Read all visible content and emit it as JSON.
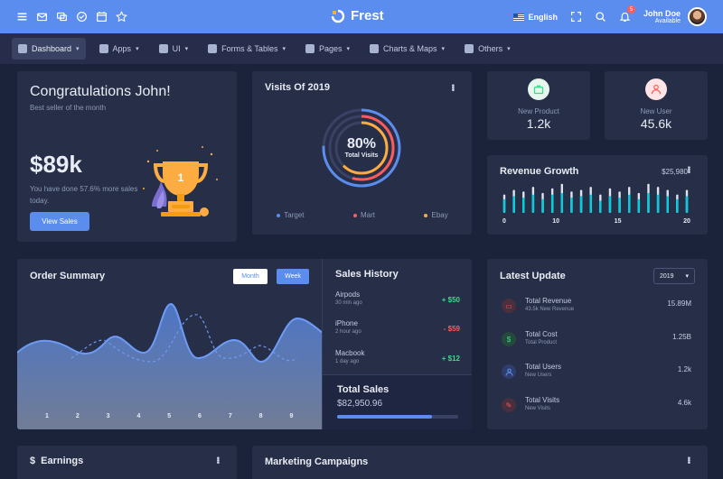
{
  "brand": {
    "name": "Frest"
  },
  "topbar": {
    "icons": [
      "menu-icon",
      "mail-icon",
      "chat-icon",
      "check-circle-icon",
      "calendar-icon",
      "star-icon"
    ],
    "language": "English",
    "notification_count": "5",
    "user": {
      "name": "John Doe",
      "status": "Available"
    }
  },
  "menu": [
    {
      "label": "Dashboard",
      "icon": "monitor-icon"
    },
    {
      "label": "Apps",
      "icon": "chat-icon"
    },
    {
      "label": "UI",
      "icon": "window-icon"
    },
    {
      "label": "Forms & Tables",
      "icon": "grid-icon"
    },
    {
      "label": "Pages",
      "icon": "page-icon"
    },
    {
      "label": "Charts & Maps",
      "icon": "pie-icon"
    },
    {
      "label": "Others",
      "icon": "folder-icon"
    }
  ],
  "congrats": {
    "title": "Congratulations John!",
    "subtitle": "Best seller of the month",
    "amount": "$89k",
    "description": "You have done 57.6% more sales today.",
    "button": "View Sales",
    "trophy_rank": "1"
  },
  "visits": {
    "title": "Visits Of 2019",
    "percent": "80%",
    "percent_value": 0.8,
    "label": "Total Visits",
    "legend": [
      {
        "name": "Target",
        "color": "#5a8dee"
      },
      {
        "name": "Mart",
        "color": "#ff5b5c"
      },
      {
        "name": "Ebay",
        "color": "#fdac41"
      }
    ]
  },
  "stats": [
    {
      "label": "New Product",
      "value": "1.2k",
      "icon": "briefcase-icon",
      "bg": "#e6f8ee",
      "fg": "#39da8a"
    },
    {
      "label": "New User",
      "value": "45.6k",
      "icon": "user-icon",
      "bg": "#ffe5e5",
      "fg": "#ff5b5c"
    }
  ],
  "revenue": {
    "title": "Revenue Growth",
    "total": "$25,980",
    "x_labels": [
      "0",
      "10",
      "15",
      "20"
    ],
    "bars": [
      {
        "total": 0.6,
        "part": 0.45
      },
      {
        "total": 0.75,
        "part": 0.55
      },
      {
        "total": 0.7,
        "part": 0.5
      },
      {
        "total": 0.85,
        "part": 0.6
      },
      {
        "total": 0.65,
        "part": 0.45
      },
      {
        "total": 0.8,
        "part": 0.6
      },
      {
        "total": 0.95,
        "part": 0.65
      },
      {
        "total": 0.7,
        "part": 0.5
      },
      {
        "total": 0.75,
        "part": 0.55
      },
      {
        "total": 0.85,
        "part": 0.6
      },
      {
        "total": 0.6,
        "part": 0.4
      },
      {
        "total": 0.8,
        "part": 0.55
      },
      {
        "total": 0.7,
        "part": 0.5
      },
      {
        "total": 0.85,
        "part": 0.6
      },
      {
        "total": 0.65,
        "part": 0.45
      },
      {
        "total": 0.95,
        "part": 0.65
      },
      {
        "total": 0.85,
        "part": 0.6
      },
      {
        "total": 0.75,
        "part": 0.55
      },
      {
        "total": 0.6,
        "part": 0.45
      },
      {
        "total": 0.75,
        "part": 0.55
      }
    ]
  },
  "order_summary": {
    "title": "Order Summary",
    "buttons": {
      "month": "Month",
      "week": "Week"
    },
    "x_labels": [
      "1",
      "2",
      "3",
      "4",
      "5",
      "6",
      "7",
      "8",
      "9"
    ]
  },
  "sales_history": {
    "title": "Sales History",
    "items": [
      {
        "name": "Airpods",
        "time": "30 min ago",
        "amount": "+ $50",
        "color": "#39da8a"
      },
      {
        "name": "iPhone",
        "time": "2 hour ago",
        "amount": "- $59",
        "color": "#ff5b5c"
      },
      {
        "name": "Macbook",
        "time": "1 day ago",
        "amount": "+ $12",
        "color": "#39da8a"
      }
    ],
    "total_label": "Total Sales",
    "total_value": "$82,950.96",
    "total_progress": 0.78
  },
  "latest_update": {
    "title": "Latest Update",
    "year": "2019",
    "items": [
      {
        "title": "Total Revenue",
        "subtitle": "43.5k New Revenue",
        "value": "15.89M",
        "icon": "card-icon",
        "fg": "#ff5b5c",
        "bg": "#4a2f3e"
      },
      {
        "title": "Total Cost",
        "subtitle": "Total Product",
        "value": "1.25B",
        "icon": "dollar-icon",
        "fg": "#39da8a",
        "bg": "#254a3d"
      },
      {
        "title": "Total Users",
        "subtitle": "New Users",
        "value": "1.2k",
        "icon": "user-icon",
        "fg": "#5a8dee",
        "bg": "#2f3d6a"
      },
      {
        "title": "Total Visits",
        "subtitle": "New Visits",
        "value": "4.6k",
        "icon": "edit-icon",
        "fg": "#ff5b5c",
        "bg": "#4a2f3e"
      }
    ]
  },
  "earnings": {
    "title": "Earnings",
    "currency_symbol": "$"
  },
  "marketing": {
    "title": "Marketing Campaigns"
  }
}
